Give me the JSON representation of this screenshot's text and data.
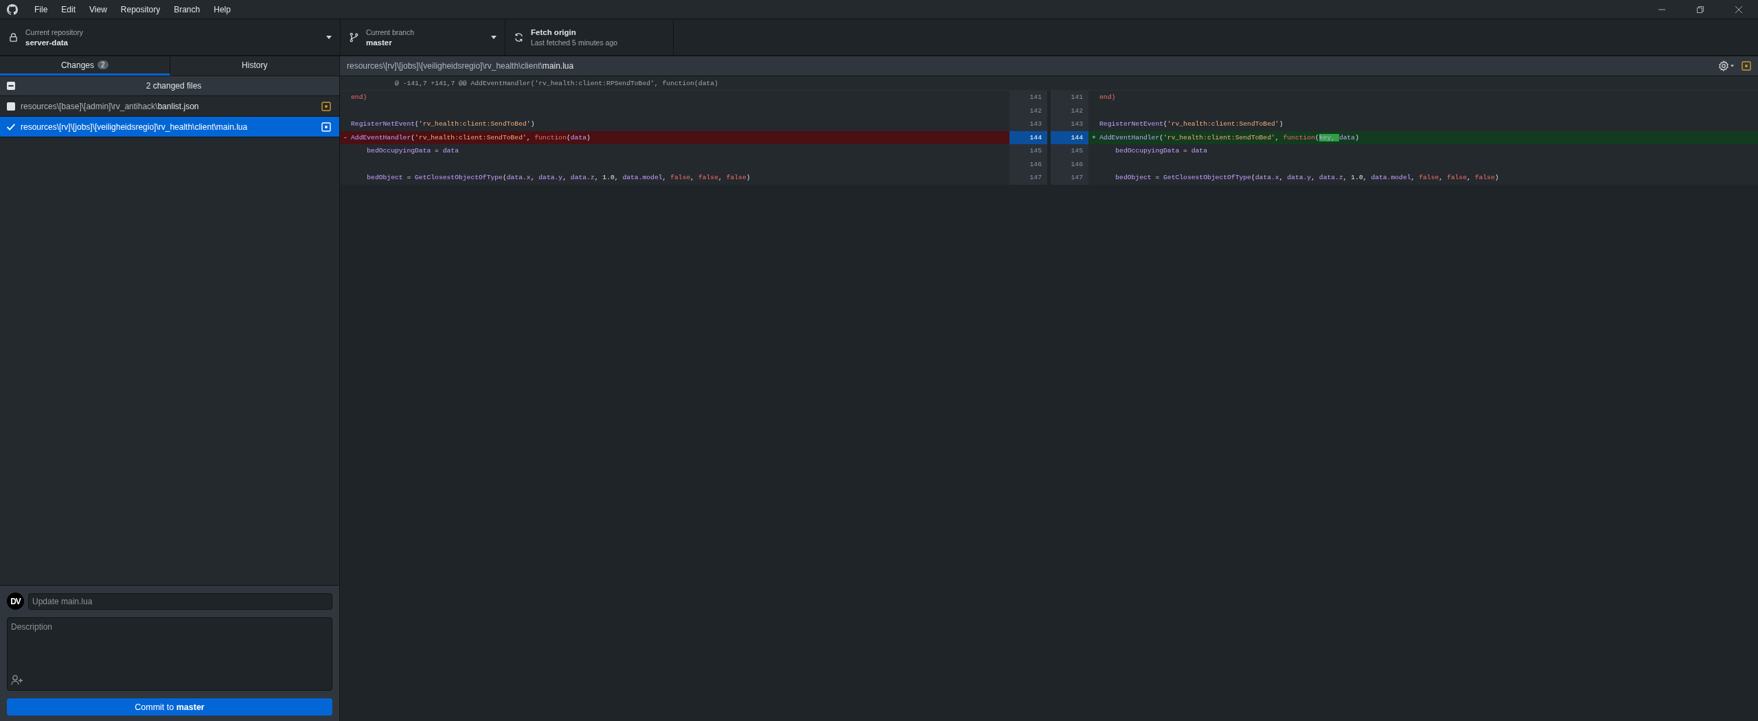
{
  "menu": [
    "File",
    "Edit",
    "View",
    "Repository",
    "Branch",
    "Help"
  ],
  "toolbar": {
    "repository": {
      "label": "Current repository",
      "name": "server-data"
    },
    "branch": {
      "label": "Current branch",
      "name": "master"
    },
    "fetch": {
      "title": "Fetch origin",
      "subtitle": "Last fetched 5 minutes ago"
    }
  },
  "tabs": [
    {
      "label": "Changes",
      "count": "2",
      "selected": true
    },
    {
      "label": "History",
      "selected": false
    }
  ],
  "changes": {
    "summary": "2 changed files",
    "indeterminate": true,
    "files": [
      {
        "path": "resources\\[base]\\[admin]\\rv_antihack\\**banlist.json**",
        "checked": false,
        "selected": false,
        "kind": "modified"
      },
      {
        "path": "resources\\[rv]\\[jobs]\\[veiligheidsregio]\\rv_health\\client\\**main.lua**",
        "checked": true,
        "selected": true,
        "kind": "modified"
      }
    ]
  },
  "commit": {
    "avatar": "DV",
    "summary_placeholder": "Update main.lua",
    "description_placeholder": "Description",
    "button": "Commit to **master**"
  },
  "diff": {
    "path": "resources\\[rv]\\[jobs]\\[veiligheidsregio]\\rv_health\\client\\**main.lua**",
    "kind": "modified",
    "hunk_header": "@ -141,7 +141,7 @@ AddEventHandler('rv_health:client:RPSendToBed', function(data)",
    "rows": [
      {
        "old_number": "141",
        "new_number": "141",
        "kind": "context",
        "selected": false,
        "left": [
          {
            "text": "end)",
            "kind": "keyword"
          }
        ],
        "right": [
          {
            "text": "end)",
            "kind": "keyword"
          }
        ]
      },
      {
        "old_number": "142",
        "new_number": "142",
        "kind": "context",
        "selected": false
      },
      {
        "old_number": "143",
        "new_number": "143",
        "kind": "context",
        "selected": false,
        "left": [
          {
            "text": "RegisterNetEvent",
            "kind": "function"
          },
          {
            "text": "(",
            "kind": "plain"
          },
          {
            "text": "'rv_health:client:SendToBed'",
            "kind": "string"
          },
          {
            "text": ")",
            "kind": "plain"
          }
        ],
        "right": [
          {
            "text": "RegisterNetEvent",
            "kind": "function"
          },
          {
            "text": "(",
            "kind": "plain"
          },
          {
            "text": "'rv_health:client:SendToBed'",
            "kind": "string"
          },
          {
            "text": ")",
            "kind": "plain"
          }
        ]
      },
      {
        "old_number": "144",
        "new_number": "144",
        "kind": "change",
        "selected": true,
        "left_marker": "-",
        "right_marker": "+",
        "left": [
          {
            "text": "AddEventHandler",
            "kind": "function"
          },
          {
            "text": "(",
            "kind": "plain"
          },
          {
            "text": "'rv_health:client:SendToBed'",
            "kind": "string"
          },
          {
            "text": ", ",
            "kind": "plain"
          },
          {
            "text": "function",
            "kind": "keyword"
          },
          {
            "text": "(",
            "kind": "plain"
          },
          {
            "text": "data",
            "kind": "function"
          },
          {
            "text": ")",
            "kind": "plain"
          }
        ],
        "right": [
          {
            "text": "AddEventHandler",
            "kind": "function"
          },
          {
            "text": "(",
            "kind": "plain"
          },
          {
            "text": "'rv_health:client:SendToBed'",
            "kind": "string"
          },
          {
            "text": ", ",
            "kind": "plain"
          },
          {
            "text": "function",
            "kind": "keyword"
          },
          {
            "text": "(",
            "kind": "plain"
          },
          {
            "text": "key, ",
            "kind": "inserted"
          },
          {
            "text": "data",
            "kind": "function"
          },
          {
            "text": ")",
            "kind": "plain"
          }
        ]
      },
      {
        "old_number": "145",
        "new_number": "145",
        "kind": "context",
        "selected": false,
        "left": [
          {
            "text": "    bedOccupyingData",
            "kind": "function"
          },
          {
            "text": " = ",
            "kind": "plain"
          },
          {
            "text": "data",
            "kind": "function"
          }
        ],
        "right": [
          {
            "text": "    bedOccupyingData",
            "kind": "function"
          },
          {
            "text": " = ",
            "kind": "plain"
          },
          {
            "text": "data",
            "kind": "function"
          }
        ]
      },
      {
        "old_number": "146",
        "new_number": "146",
        "kind": "context",
        "selected": false
      },
      {
        "old_number": "147",
        "new_number": "147",
        "kind": "context",
        "selected": false,
        "left": [
          {
            "text": "    bedObject",
            "kind": "function"
          },
          {
            "text": " = ",
            "kind": "plain"
          },
          {
            "text": "GetClosestObjectOfType",
            "kind": "function"
          },
          {
            "text": "(",
            "kind": "plain"
          },
          {
            "text": "data.x",
            "kind": "function"
          },
          {
            "text": ", ",
            "kind": "plain"
          },
          {
            "text": "data.y",
            "kind": "function"
          },
          {
            "text": ", ",
            "kind": "plain"
          },
          {
            "text": "data.z",
            "kind": "function"
          },
          {
            "text": ", 1.0, ",
            "kind": "plain"
          },
          {
            "text": "data.model",
            "kind": "function"
          },
          {
            "text": ", ",
            "kind": "plain"
          },
          {
            "text": "false",
            "kind": "keyword"
          },
          {
            "text": ", ",
            "kind": "plain"
          },
          {
            "text": "false",
            "kind": "keyword"
          },
          {
            "text": ", ",
            "kind": "plain"
          },
          {
            "text": "false",
            "kind": "keyword"
          },
          {
            "text": ")",
            "kind": "plain"
          }
        ],
        "right": [
          {
            "text": "    bedObject",
            "kind": "function"
          },
          {
            "text": " = ",
            "kind": "plain"
          },
          {
            "text": "GetClosestObjectOfType",
            "kind": "function"
          },
          {
            "text": "(",
            "kind": "plain"
          },
          {
            "text": "data.x",
            "kind": "function"
          },
          {
            "text": ", ",
            "kind": "plain"
          },
          {
            "text": "data.y",
            "kind": "function"
          },
          {
            "text": ", ",
            "kind": "plain"
          },
          {
            "text": "data.z",
            "kind": "function"
          },
          {
            "text": ", 1.0, ",
            "kind": "plain"
          },
          {
            "text": "data.model",
            "kind": "function"
          },
          {
            "text": ", ",
            "kind": "plain"
          },
          {
            "text": "false",
            "kind": "keyword"
          },
          {
            "text": ", ",
            "kind": "plain"
          },
          {
            "text": "false",
            "kind": "keyword"
          },
          {
            "text": ", ",
            "kind": "plain"
          },
          {
            "text": "false",
            "kind": "keyword"
          },
          {
            "text": ")",
            "kind": "plain"
          }
        ]
      }
    ]
  }
}
